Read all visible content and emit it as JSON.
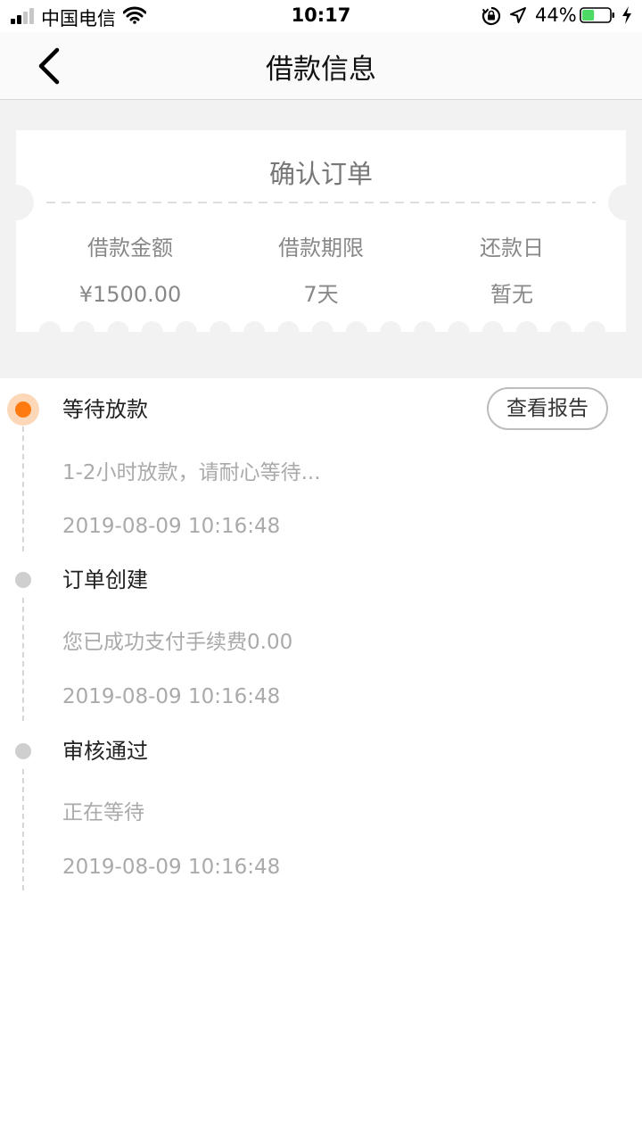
{
  "status_bar": {
    "carrier": "中国电信",
    "time": "10:17",
    "battery_percent": "44%",
    "battery_level": 0.44,
    "battery_color": "#4cd964"
  },
  "nav": {
    "title": "借款信息",
    "back_icon": "chevron-left-icon"
  },
  "order_card": {
    "title": "确认订单",
    "columns": [
      {
        "label": "借款金额",
        "value": "¥1500.00"
      },
      {
        "label": "借款期限",
        "value": "7天"
      },
      {
        "label": "还款日",
        "value": "暂无"
      }
    ]
  },
  "timeline": {
    "accent_color": "#ff7a10",
    "report_button": "查看报告",
    "items": [
      {
        "title": "等待放款",
        "desc": "1-2小时放款，请耐心等待...",
        "time": "2019-08-09 10:16:48",
        "active": true
      },
      {
        "title": "订单创建",
        "desc": "您已成功支付手续费0.00",
        "time": "2019-08-09 10:16:48",
        "active": false
      },
      {
        "title": "审核通过",
        "desc": "正在等待",
        "time": "2019-08-09 10:16:48",
        "active": false
      }
    ]
  }
}
